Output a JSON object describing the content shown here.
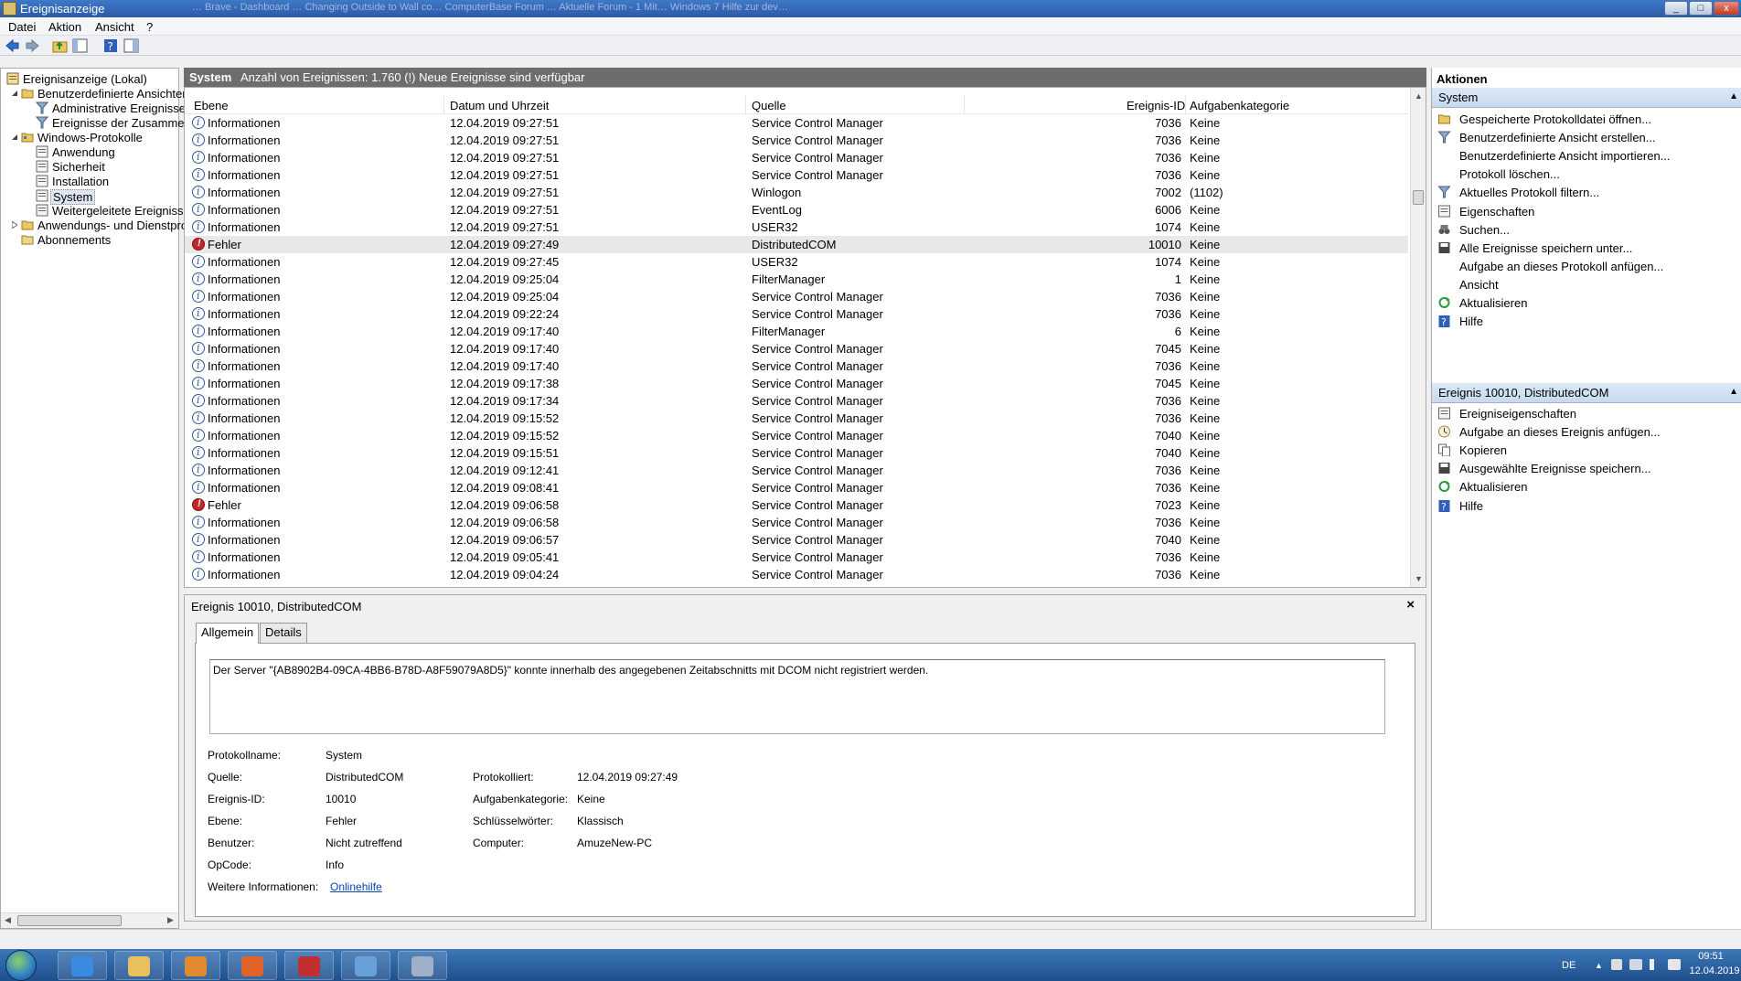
{
  "window": {
    "title": "Ereignisanzeige",
    "background_tabs": "…      Brave - Dashboard      …      Changing Outside to Wall co…      ComputerBase Forum      …      Aktuelle Forum - 1 Mit…      Windows 7 Hilfe zur dev…",
    "min_label": "_",
    "max_label": "□",
    "close_label": "x"
  },
  "menu": [
    "Datei",
    "Aktion",
    "Ansicht",
    "?"
  ],
  "tree": {
    "items": [
      {
        "label": "Ereignisanzeige (Lokal)",
        "level": 0,
        "icon": "event-viewer-icon"
      },
      {
        "label": "Benutzerdefinierte Ansichten",
        "level": 1,
        "icon": "folder-icon"
      },
      {
        "label": "Administrative Ereignisse",
        "level": 2,
        "icon": "filter-icon"
      },
      {
        "label": "Ereignisse der Zusammenfassungsseite",
        "level": 2,
        "icon": "filter-icon"
      },
      {
        "label": "Windows-Protokolle",
        "level": 1,
        "icon": "folder-icon"
      },
      {
        "label": "Anwendung",
        "level": 2,
        "icon": "log-icon"
      },
      {
        "label": "Sicherheit",
        "level": 2,
        "icon": "log-icon"
      },
      {
        "label": "Installation",
        "level": 2,
        "icon": "log-icon"
      },
      {
        "label": "System",
        "level": 2,
        "icon": "log-icon",
        "selected": true
      },
      {
        "label": "Weitergeleitete Ereignisse",
        "level": 2,
        "icon": "log-icon"
      },
      {
        "label": "Anwendungs- und Dienstprotokolle",
        "level": 1,
        "icon": "folder-icon"
      },
      {
        "label": "Abonnements",
        "level": 1,
        "icon": "subscription-icon"
      }
    ]
  },
  "center": {
    "log_name": "System",
    "summary": "Anzahl von Ereignissen: 1.760 (!) Neue Ereignisse sind verfügbar",
    "columns": [
      "Ebene",
      "Datum und Uhrzeit",
      "Quelle",
      "Ereignis-ID",
      "Aufgabenkategorie"
    ],
    "rows": [
      {
        "level": "Informationen",
        "type": "info",
        "date": "12.04.2019 09:27:51",
        "source": "Service Control Manager",
        "id": "7036",
        "category": "Keine"
      },
      {
        "level": "Informationen",
        "type": "info",
        "date": "12.04.2019 09:27:51",
        "source": "Service Control Manager",
        "id": "7036",
        "category": "Keine"
      },
      {
        "level": "Informationen",
        "type": "info",
        "date": "12.04.2019 09:27:51",
        "source": "Service Control Manager",
        "id": "7036",
        "category": "Keine"
      },
      {
        "level": "Informationen",
        "type": "info",
        "date": "12.04.2019 09:27:51",
        "source": "Service Control Manager",
        "id": "7036",
        "category": "Keine"
      },
      {
        "level": "Informationen",
        "type": "info",
        "date": "12.04.2019 09:27:51",
        "source": "Winlogon",
        "id": "7002",
        "category": "(1102)"
      },
      {
        "level": "Informationen",
        "type": "info",
        "date": "12.04.2019 09:27:51",
        "source": "EventLog",
        "id": "6006",
        "category": "Keine"
      },
      {
        "level": "Informationen",
        "type": "info",
        "date": "12.04.2019 09:27:51",
        "source": "USER32",
        "id": "1074",
        "category": "Keine"
      },
      {
        "level": "Fehler",
        "type": "error",
        "date": "12.04.2019 09:27:49",
        "source": "DistributedCOM",
        "id": "10010",
        "category": "Keine",
        "selected": true
      },
      {
        "level": "Informationen",
        "type": "info",
        "date": "12.04.2019 09:27:45",
        "source": "USER32",
        "id": "1074",
        "category": "Keine"
      },
      {
        "level": "Informationen",
        "type": "info",
        "date": "12.04.2019 09:25:04",
        "source": "FilterManager",
        "id": "1",
        "category": "Keine"
      },
      {
        "level": "Informationen",
        "type": "info",
        "date": "12.04.2019 09:25:04",
        "source": "Service Control Manager",
        "id": "7036",
        "category": "Keine"
      },
      {
        "level": "Informationen",
        "type": "info",
        "date": "12.04.2019 09:22:24",
        "source": "Service Control Manager",
        "id": "7036",
        "category": "Keine"
      },
      {
        "level": "Informationen",
        "type": "info",
        "date": "12.04.2019 09:17:40",
        "source": "FilterManager",
        "id": "6",
        "category": "Keine"
      },
      {
        "level": "Informationen",
        "type": "info",
        "date": "12.04.2019 09:17:40",
        "source": "Service Control Manager",
        "id": "7045",
        "category": "Keine"
      },
      {
        "level": "Informationen",
        "type": "info",
        "date": "12.04.2019 09:17:40",
        "source": "Service Control Manager",
        "id": "7036",
        "category": "Keine"
      },
      {
        "level": "Informationen",
        "type": "info",
        "date": "12.04.2019 09:17:38",
        "source": "Service Control Manager",
        "id": "7045",
        "category": "Keine"
      },
      {
        "level": "Informationen",
        "type": "info",
        "date": "12.04.2019 09:17:34",
        "source": "Service Control Manager",
        "id": "7036",
        "category": "Keine"
      },
      {
        "level": "Informationen",
        "type": "info",
        "date": "12.04.2019 09:15:52",
        "source": "Service Control Manager",
        "id": "7036",
        "category": "Keine"
      },
      {
        "level": "Informationen",
        "type": "info",
        "date": "12.04.2019 09:15:52",
        "source": "Service Control Manager",
        "id": "7040",
        "category": "Keine"
      },
      {
        "level": "Informationen",
        "type": "info",
        "date": "12.04.2019 09:15:51",
        "source": "Service Control Manager",
        "id": "7040",
        "category": "Keine"
      },
      {
        "level": "Informationen",
        "type": "info",
        "date": "12.04.2019 09:12:41",
        "source": "Service Control Manager",
        "id": "7036",
        "category": "Keine"
      },
      {
        "level": "Informationen",
        "type": "info",
        "date": "12.04.2019 09:08:41",
        "source": "Service Control Manager",
        "id": "7036",
        "category": "Keine"
      },
      {
        "level": "Fehler",
        "type": "error",
        "date": "12.04.2019 09:06:58",
        "source": "Service Control Manager",
        "id": "7023",
        "category": "Keine"
      },
      {
        "level": "Informationen",
        "type": "info",
        "date": "12.04.2019 09:06:58",
        "source": "Service Control Manager",
        "id": "7036",
        "category": "Keine"
      },
      {
        "level": "Informationen",
        "type": "info",
        "date": "12.04.2019 09:06:57",
        "source": "Service Control Manager",
        "id": "7040",
        "category": "Keine"
      },
      {
        "level": "Informationen",
        "type": "info",
        "date": "12.04.2019 09:05:41",
        "source": "Service Control Manager",
        "id": "7036",
        "category": "Keine"
      },
      {
        "level": "Informationen",
        "type": "info",
        "date": "12.04.2019 09:04:24",
        "source": "Service Control Manager",
        "id": "7036",
        "category": "Keine"
      }
    ]
  },
  "detail": {
    "title": "Ereignis 10010, DistributedCOM",
    "close": "×",
    "tabs": [
      "Allgemein",
      "Details"
    ],
    "message": "Der Server \"{AB8902B4-09CA-4BB6-B78D-A8F59079A8D5}\" konnte innerhalb des angegebenen Zeitabschnitts mit DCOM nicht registriert werden.",
    "labels": {
      "log": "Protokollname:",
      "source": "Quelle:",
      "event_id": "Ereignis-ID:",
      "level": "Ebene:",
      "user": "Benutzer:",
      "opcode": "OpCode:",
      "more": "Weitere Informationen:",
      "logged": "Protokolliert:",
      "task": "Aufgabenkategorie:",
      "keywords": "Schlüsselwörter:",
      "computer": "Computer:"
    },
    "values": {
      "log": "System",
      "source": "DistributedCOM",
      "event_id": "10010",
      "level": "Fehler",
      "user": "Nicht zutreffend",
      "opcode": "Info",
      "more": "Onlinehilfe",
      "logged": "12.04.2019 09:27:49",
      "task": "Keine",
      "keywords": "Klassisch",
      "computer": "AmuzeNew-PC"
    }
  },
  "actions": {
    "title": "Aktionen",
    "section1": "System",
    "items1": [
      {
        "label": "Gespeicherte Protokolldatei öffnen...",
        "icon": "open-folder-icon"
      },
      {
        "label": "Benutzerdefinierte Ansicht erstellen...",
        "icon": "filter-icon"
      },
      {
        "label": "Benutzerdefinierte Ansicht importieren...",
        "icon": ""
      },
      {
        "label": "Protokoll löschen...",
        "icon": ""
      },
      {
        "label": "Aktuelles Protokoll filtern...",
        "icon": "filter-icon"
      },
      {
        "label": "Eigenschaften",
        "icon": "properties-icon"
      },
      {
        "label": "Suchen...",
        "icon": "binoculars-icon"
      },
      {
        "label": "Alle Ereignisse speichern unter...",
        "icon": "save-icon"
      },
      {
        "label": "Aufgabe an dieses Protokoll anfügen...",
        "icon": ""
      },
      {
        "label": "Ansicht",
        "icon": ""
      },
      {
        "label": "Aktualisieren",
        "icon": "refresh-icon"
      },
      {
        "label": "Hilfe",
        "icon": "help-icon"
      }
    ],
    "section2": "Ereignis 10010, DistributedCOM",
    "items2": [
      {
        "label": "Ereigniseigenschaften",
        "icon": "properties-icon"
      },
      {
        "label": "Aufgabe an dieses Ereignis anfügen...",
        "icon": "task-icon"
      },
      {
        "label": "Kopieren",
        "icon": "copy-icon"
      },
      {
        "label": "Ausgewählte Ereignisse speichern...",
        "icon": "save-icon"
      },
      {
        "label": "Aktualisieren",
        "icon": "refresh-icon"
      },
      {
        "label": "Hilfe",
        "icon": "help-icon"
      }
    ],
    "collapse": "▲"
  },
  "taskbar": {
    "apps": [
      "internet-explorer-icon",
      "explorer-folder-icon",
      "media-player-icon",
      "firefox-icon",
      "toolbox-icon",
      "control-panel-icon",
      "settings-gear-icon"
    ],
    "language": "DE",
    "time": "09:51",
    "date": "12.04.2019"
  },
  "colors": {
    "accent": "#2c5aa8",
    "error": "#c0282d",
    "info": "#33579a",
    "header_gray": "#6d6d6d"
  }
}
